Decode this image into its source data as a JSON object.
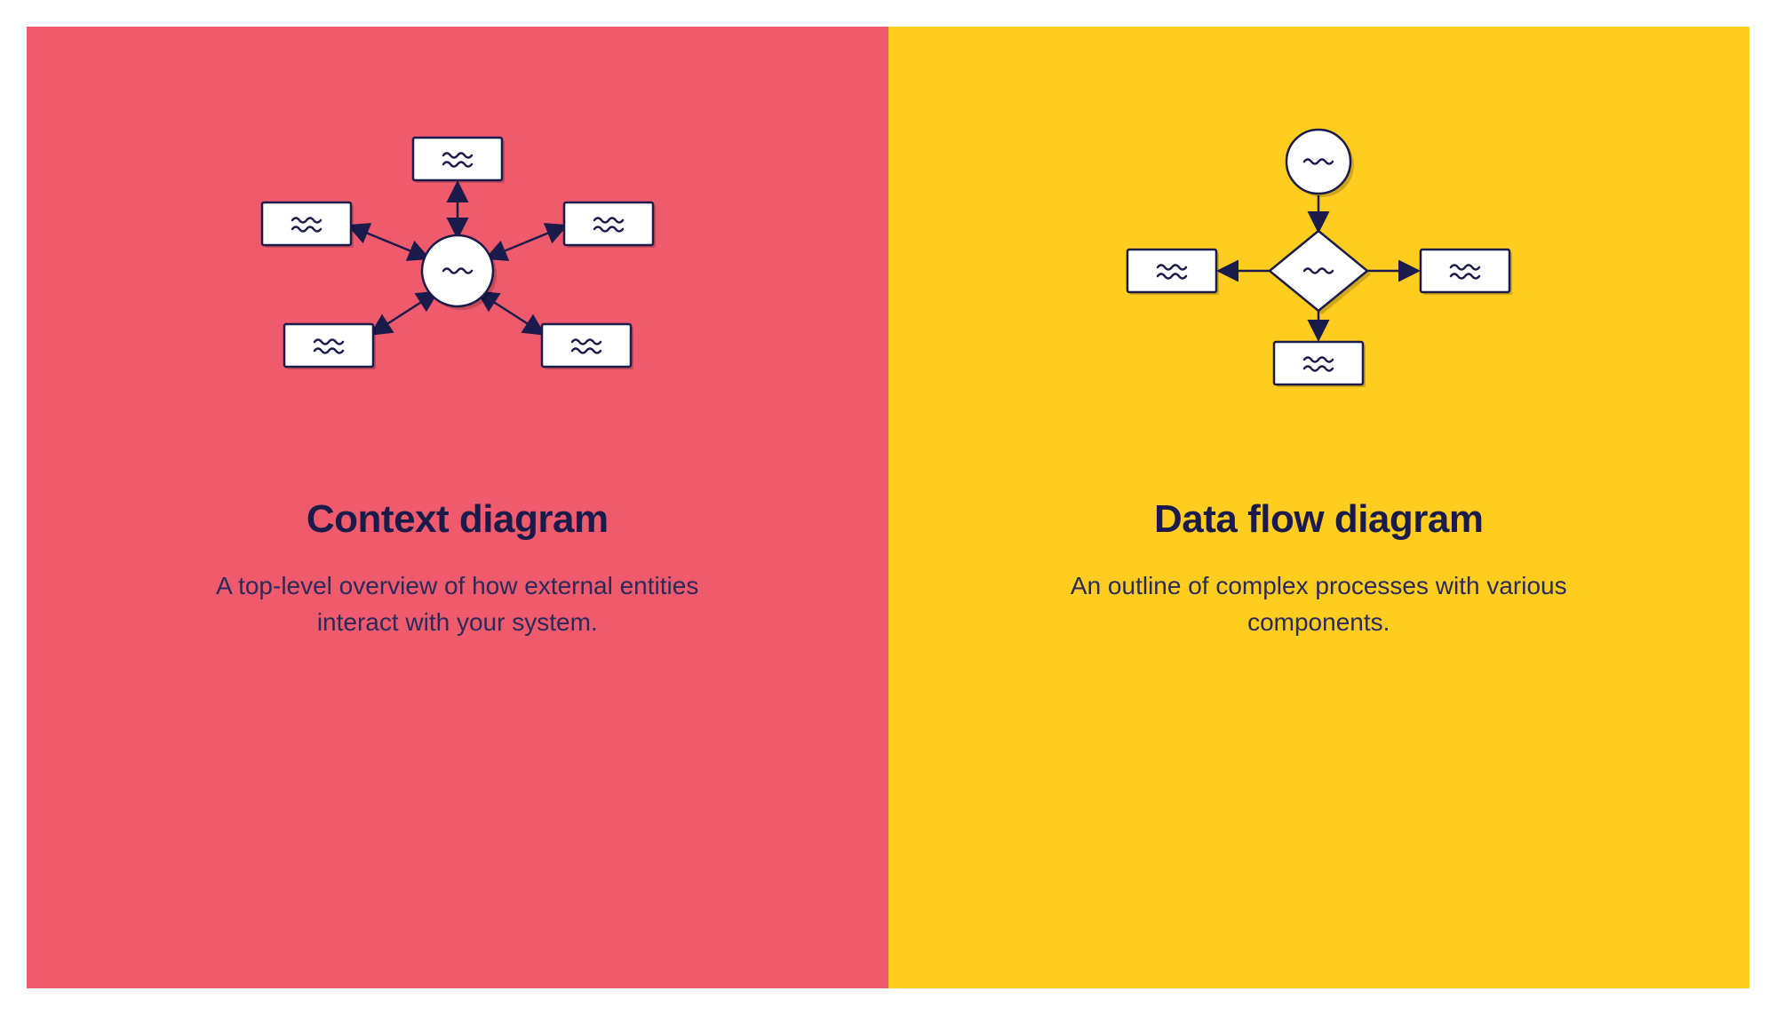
{
  "left": {
    "title": "Context diagram",
    "description": "A top-level overview of how external entities interact with your system.",
    "bg_color": "#ef5b6d"
  },
  "right": {
    "title": "Data flow diagram",
    "description": "An outline of complex processes with various components.",
    "bg_color": "#ffcd1f"
  },
  "diagram": {
    "left": {
      "type": "context",
      "center_shape": "circle",
      "entities": 5,
      "entity_shape": "rectangle",
      "connections": "bidirectional-radial"
    },
    "right": {
      "type": "data-flow",
      "shapes": [
        "circle",
        "diamond",
        "rectangle",
        "rectangle",
        "rectangle"
      ],
      "flow": "top-down-with-branches"
    }
  },
  "colors": {
    "stroke": "#1a1b4b",
    "fill": "#ffffff",
    "text": "#1a1b4b"
  }
}
